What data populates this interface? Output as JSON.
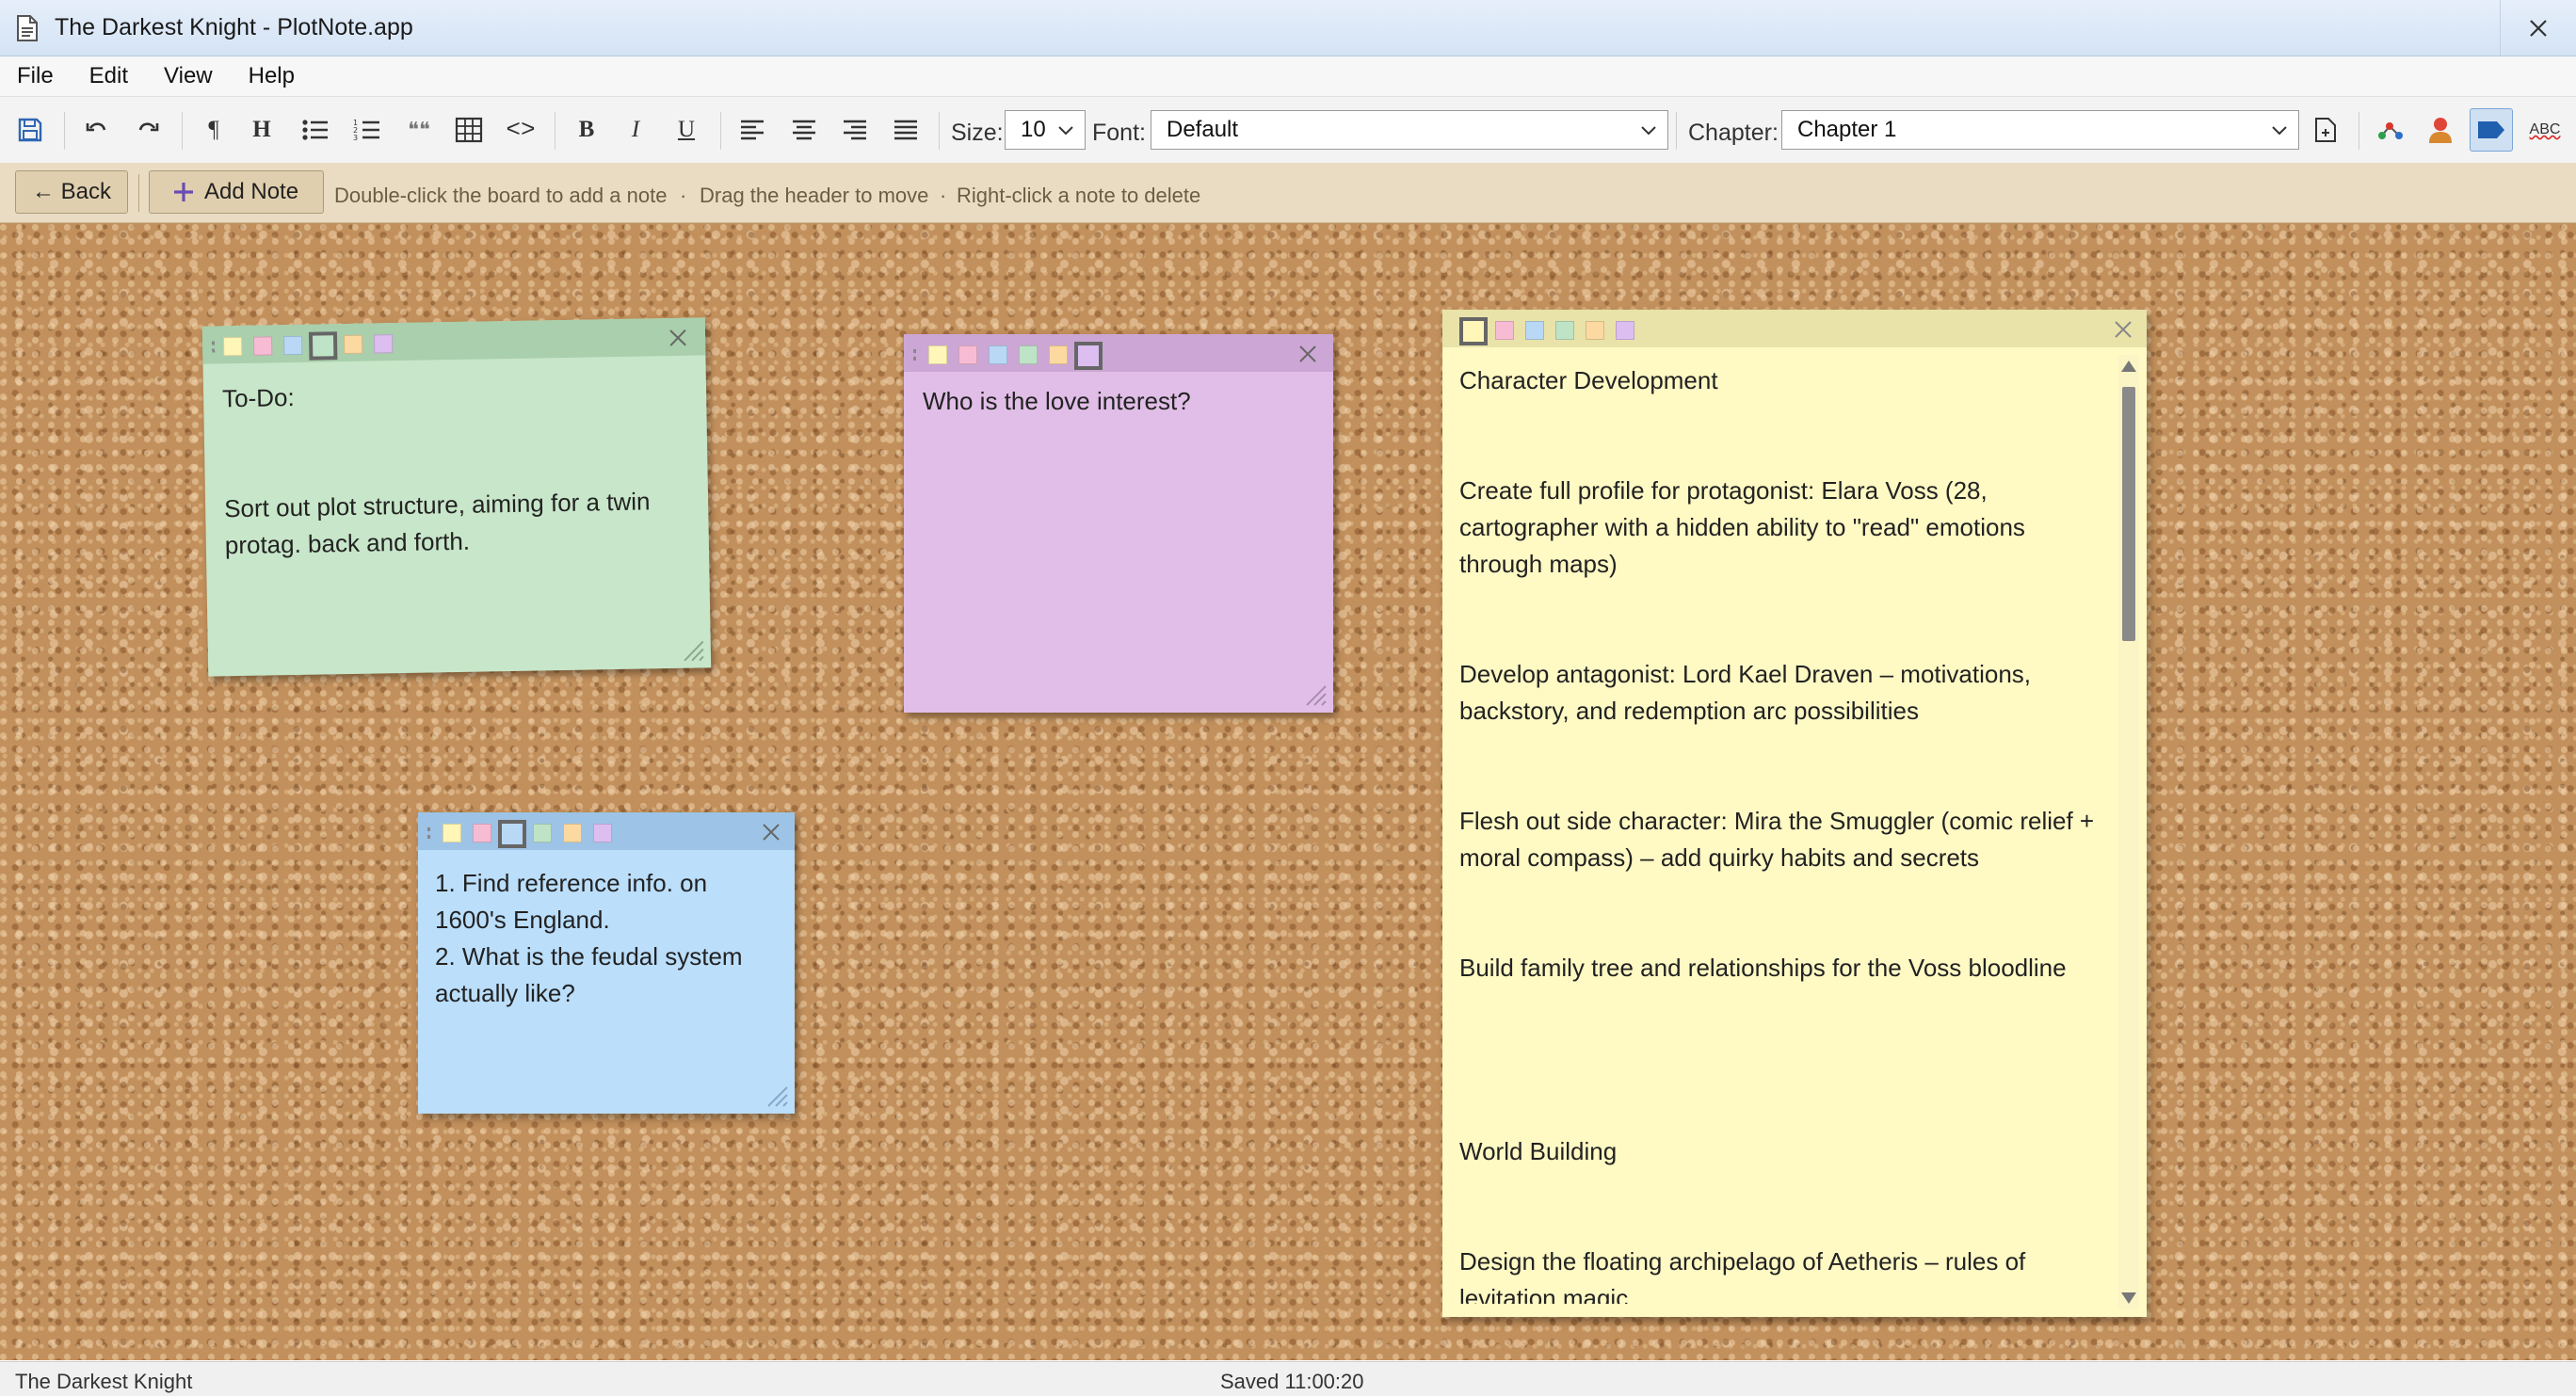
{
  "window": {
    "title": "The Darkest Knight - PlotNote.app"
  },
  "menu": [
    "File",
    "Edit",
    "View",
    "Help"
  ],
  "toolbar": {
    "paragraph_glyph": "¶",
    "heading_glyph": "H",
    "quote_glyph": "❝❝",
    "code_glyph": "<>",
    "bold_glyph": "B",
    "italic_glyph": "I",
    "underline_glyph": "U",
    "size_label": "Size:",
    "size_value": "10",
    "font_label": "Font:",
    "font_value": "Default",
    "chapter_label": "Chapter:",
    "chapter_value": "Chapter 1",
    "spell_glyph": "ABC"
  },
  "actionbar": {
    "back_label": "← Back",
    "add_note_label": "Add Note",
    "hint1": "Double-click the board to add a note",
    "hint2": "Drag the header to move",
    "hint3": "Right-click a note to delete",
    "dot": "·"
  },
  "colors": {
    "swatches": [
      "#fff6b8",
      "#f7bcd4",
      "#b8d8f5",
      "#bfe3c6",
      "#fcd9a0",
      "#dcbff0"
    ],
    "note_green": "#c8e6c9",
    "note_purple": "#e1bee7",
    "note_blue": "#bbdefb",
    "note_yellow": "#fff9c4"
  },
  "notes": {
    "green": {
      "text": "To-Do:\n\n\nSort out plot structure, aiming for a twin protag. back and forth."
    },
    "purple": {
      "text": "Who is the love interest?"
    },
    "blue": {
      "text": "1. Find reference info. on 1600's England.\n2. What is the feudal system actually like?"
    },
    "yellow": {
      "text": "Character Development\n\n\nCreate full profile for protagonist: Elara Voss (28, cartographer with a hidden ability to \"read\" emotions through maps)\n\n\nDevelop antagonist: Lord Kael Draven – motivations, backstory, and redemption arc possibilities\n\n\nFlesh out side character: Mira the Smuggler (comic relief + moral compass) – add quirky habits and secrets\n\n\nBuild family tree and relationships for the Voss bloodline\n\n\n\n\nWorld Building\n\n\nDesign the floating archipelago of Aetheris – rules of levitation magic"
    }
  },
  "status": {
    "left": "The Darkest Knight",
    "center": "Saved 11:00:20"
  }
}
